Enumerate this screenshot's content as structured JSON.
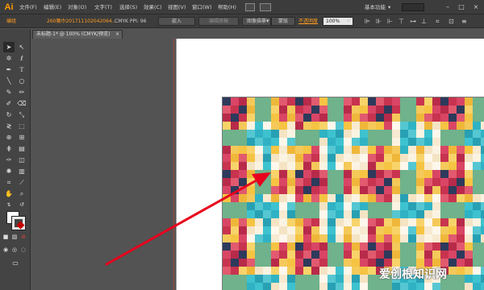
{
  "app": {
    "logo": "Ai"
  },
  "menubar": {
    "items": [
      "文件(F)",
      "编辑(E)",
      "对象(O)",
      "文字(T)",
      "选择(S)",
      "效果(C)",
      "视图(V)",
      "窗口(W)",
      "帮助(H)"
    ],
    "workspace": "基本功能"
  },
  "controlbar": {
    "group_label": "编组",
    "file_name": "260魔巾201711102042064...",
    "color_mode": "CMYK PPI: 96",
    "embed_button": "嵌入",
    "edit_original": "编辑原稿",
    "image_trace": "图像描摹",
    "mask_button": "蒙版",
    "opacity_label": "不透明度",
    "opacity_value": "100%"
  },
  "document": {
    "tab_title": "未标题-1* @ 100% (CMYK/预览)",
    "tab_close": "×"
  },
  "colors": {
    "accent": "#ff9d1f",
    "arrow": "#e8001c"
  },
  "watermark": "爱创根知识网"
}
